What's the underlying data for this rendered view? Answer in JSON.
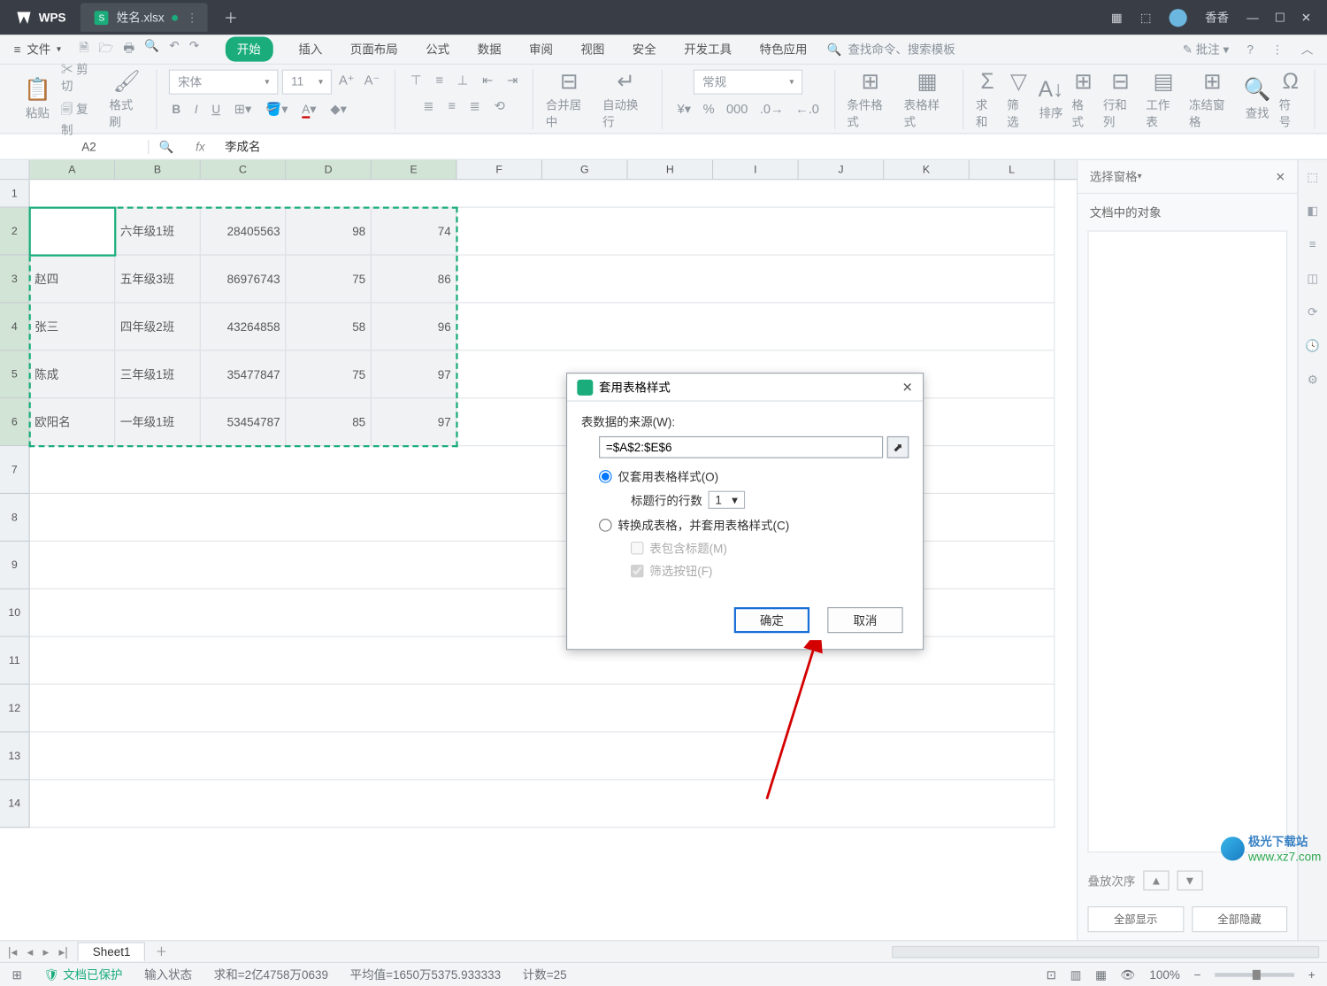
{
  "titlebar": {
    "app": "WPS",
    "tab_name": "姓名.xlsx",
    "user_name": "香香"
  },
  "menubar": {
    "file": "文件",
    "tabs": [
      "开始",
      "插入",
      "页面布局",
      "公式",
      "数据",
      "审阅",
      "视图",
      "安全",
      "开发工具",
      "特色应用"
    ],
    "search_placeholder": "查找命令、搜索模板",
    "comment": "批注"
  },
  "ribbon": {
    "paste": "粘贴",
    "cut": "剪切",
    "copy": "复制",
    "format_painter": "格式刷",
    "font_name": "宋体",
    "font_size": "11",
    "merge": "合并居中",
    "wrap": "自动换行",
    "number_format": "常规",
    "cond_format": "条件格式",
    "table_style": "表格样式",
    "sum": "求和",
    "filter": "筛选",
    "sort": "排序",
    "format": "格式",
    "rowcol": "行和列",
    "sheet": "工作表",
    "freeze": "冻结窗格",
    "find": "查找",
    "symbol": "符号"
  },
  "fxbar": {
    "name": "A2",
    "formula": "李成名"
  },
  "grid": {
    "columns": [
      "A",
      "B",
      "C",
      "D",
      "E",
      "F",
      "G",
      "H",
      "I",
      "J",
      "K",
      "L"
    ],
    "row_numbers": [
      "1",
      "2",
      "3",
      "4",
      "5",
      "6",
      "7",
      "8",
      "9",
      "10",
      "11",
      "12",
      "13",
      "14"
    ],
    "rows": [
      {
        "a": "李成名",
        "b": "六年级1班",
        "c": "28405563",
        "d": "98",
        "e": "74"
      },
      {
        "a": "赵四",
        "b": "五年级3班",
        "c": "86976743",
        "d": "75",
        "e": "86"
      },
      {
        "a": "张三",
        "b": "四年级2班",
        "c": "43264858",
        "d": "58",
        "e": "96"
      },
      {
        "a": "陈成",
        "b": "三年级1班",
        "c": "35477847",
        "d": "75",
        "e": "97"
      },
      {
        "a": "欧阳名",
        "b": "一年级1班",
        "c": "53454787",
        "d": "85",
        "e": "97"
      }
    ]
  },
  "dialog": {
    "title": "套用表格样式",
    "src_label": "表数据的来源(W):",
    "src_value": "=$A$2:$E$6",
    "opt1": "仅套用表格样式(O)",
    "header_rows_label": "标题行的行数",
    "header_rows_value": "1",
    "opt2": "转换成表格，并套用表格样式(C)",
    "has_header": "表包含标题(M)",
    "filter_btn": "筛选按钮(F)",
    "ok": "确定",
    "cancel": "取消"
  },
  "sidepane": {
    "title": "选择窗格",
    "subtitle": "文档中的对象",
    "stack_label": "叠放次序",
    "show_all": "全部显示",
    "hide_all": "全部隐藏"
  },
  "sheets": {
    "sheet1": "Sheet1"
  },
  "statusbar": {
    "protect": "文档已保护",
    "mode": "输入状态",
    "sum": "求和=2亿4758万0639",
    "avg": "平均值=1650万5375.933333",
    "count": "计数=25",
    "zoom": "100%"
  },
  "watermark": {
    "name": "极光下载站",
    "url": "www.xz7.com"
  }
}
